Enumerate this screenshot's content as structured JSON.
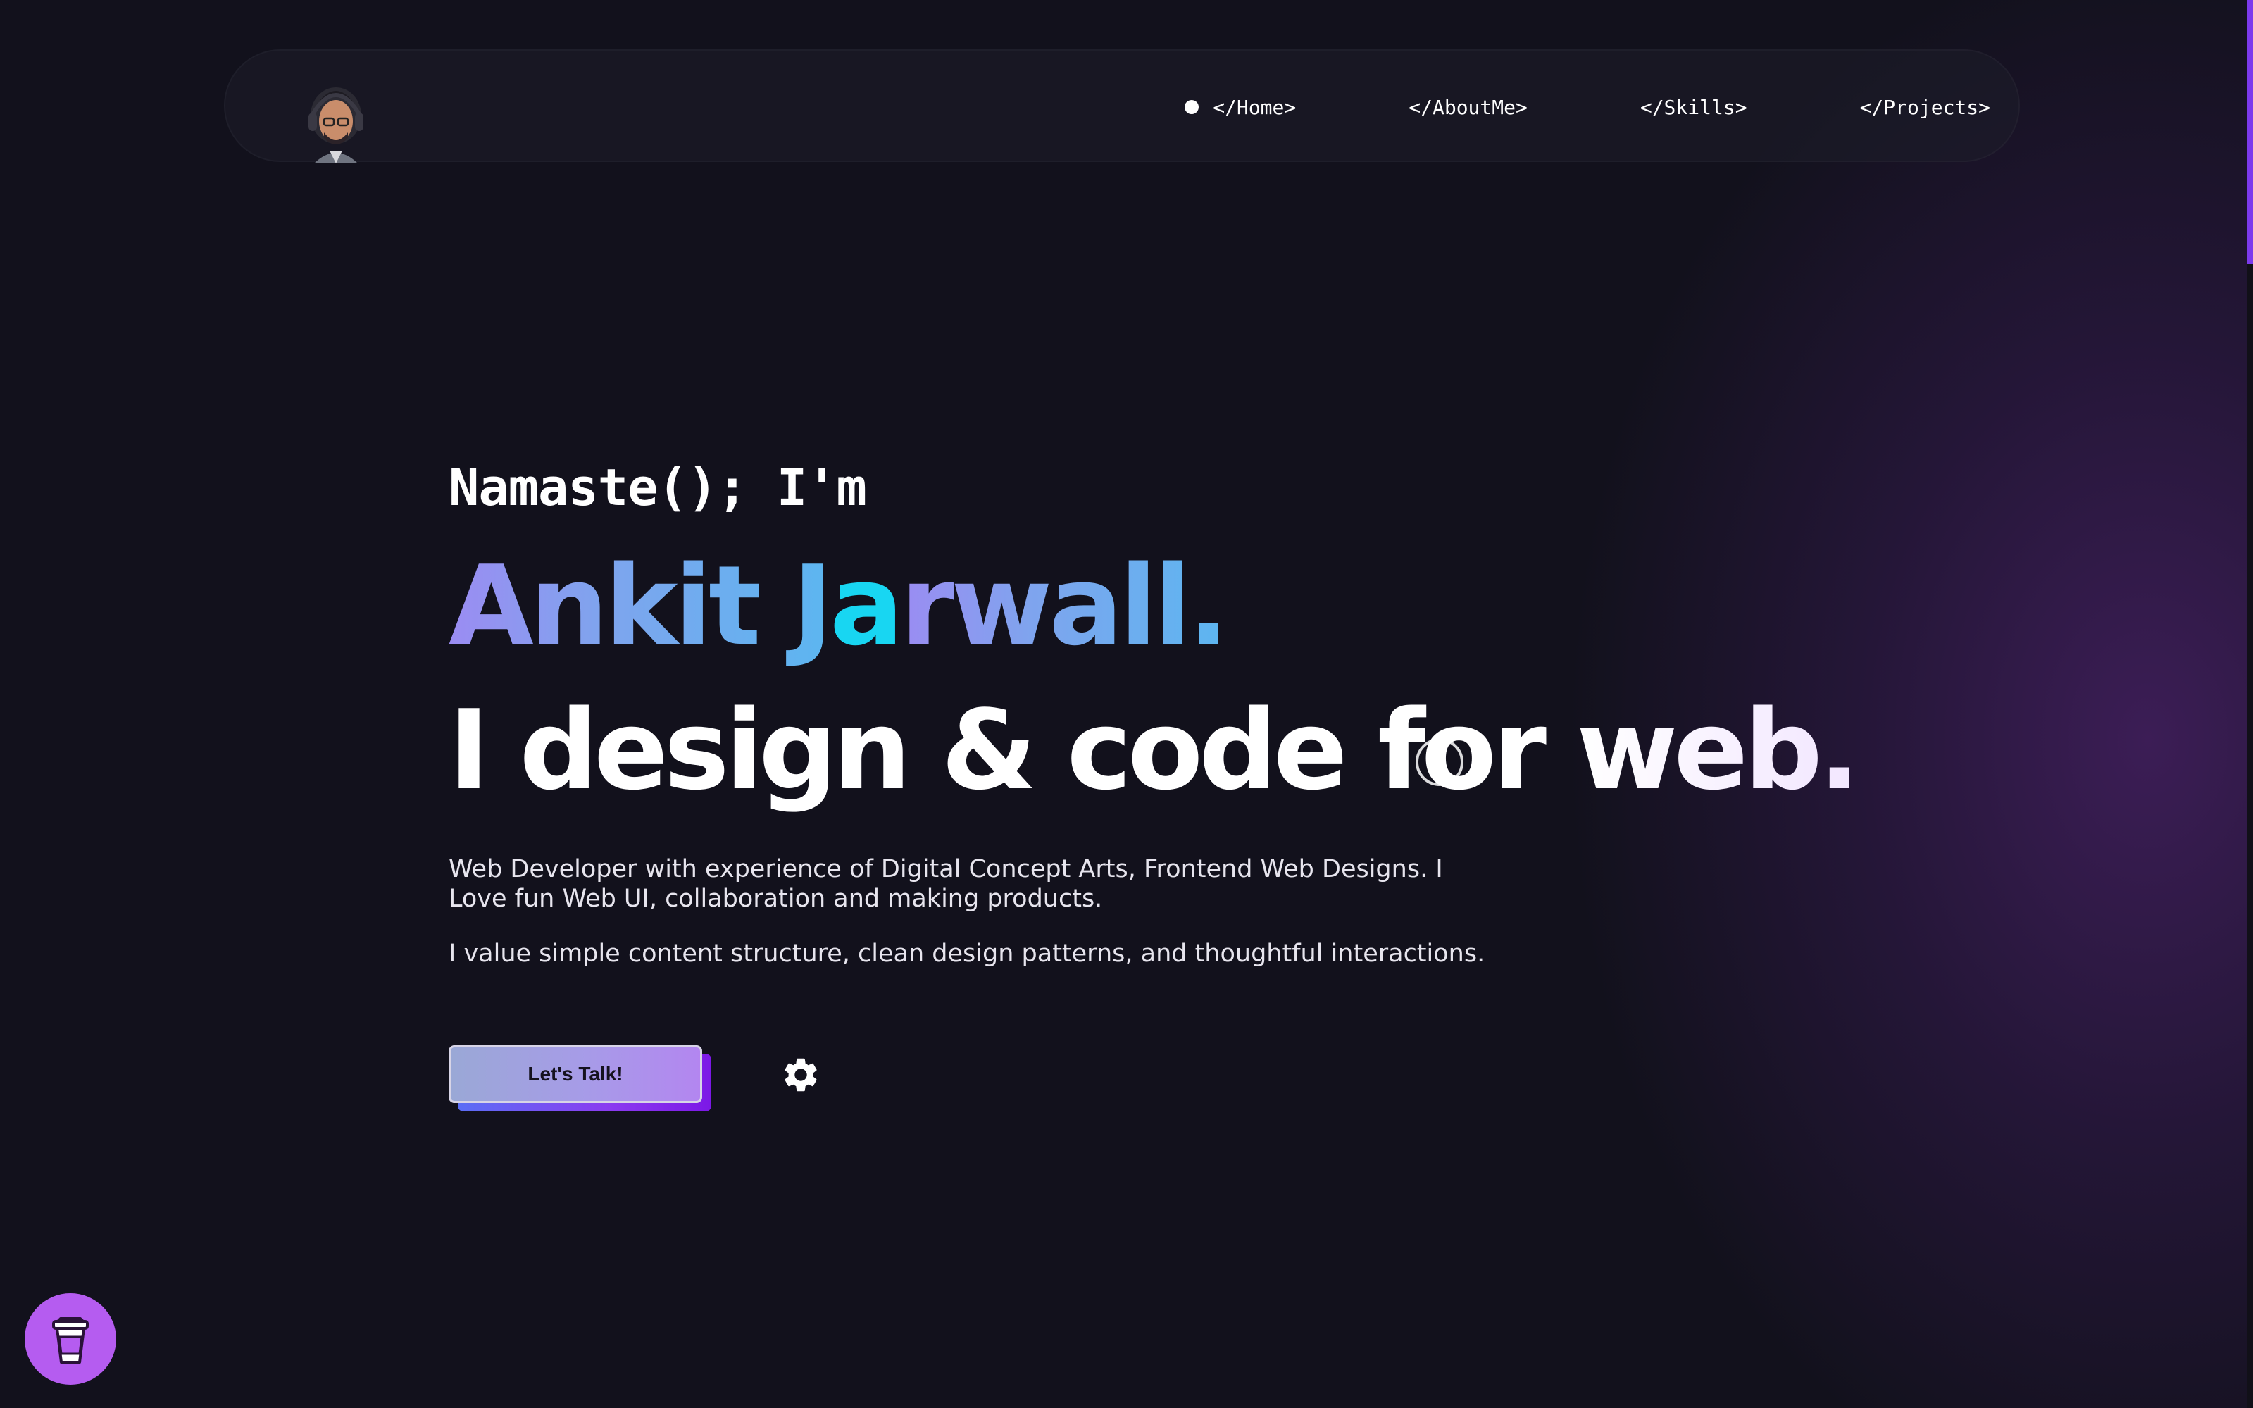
{
  "nav": {
    "items": [
      {
        "label": "</Home>",
        "active": true
      },
      {
        "label": "</AboutMe>",
        "active": false
      },
      {
        "label": "</Skills>",
        "active": false
      },
      {
        "label": "</Projects>",
        "active": false
      }
    ]
  },
  "hero": {
    "greeting": "Namaste(); I'm",
    "name_part1": "Ankit J",
    "name_accent": "a",
    "name_part2": "rwall.",
    "headline_part1": "I design & code for ",
    "headline_part2": "web.",
    "intro_line1": "Web Developer with experience of Digital Concept Arts, Frontend Web Designs. I Love fun Web UI, collaboration and making products.",
    "intro_line2": "I value simple content structure, clean design patterns, and thoughtful interactions.",
    "cta_label": "Let's Talk!"
  },
  "icons": {
    "settings": "gear-icon",
    "coffee": "coffee-cup-icon",
    "avatar": "avatar"
  },
  "colors": {
    "background": "#12111c",
    "accent_purple": "#7c3aed",
    "name_accent": "#18d6f2",
    "coffee_button": "#b55cf0"
  }
}
